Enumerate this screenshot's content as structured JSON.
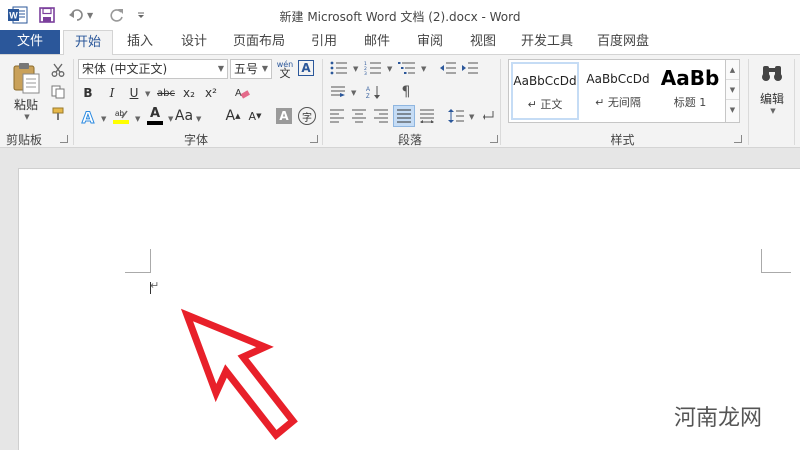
{
  "titlebar": {
    "title": "新建 Microsoft Word 文档 (2).docx - Word",
    "app_logo": "word-logo-icon",
    "quick_access": [
      "save-icon",
      "undo-icon",
      "redo-icon",
      "customize-icon"
    ]
  },
  "tabs": {
    "file": "文件",
    "items": [
      "开始",
      "插入",
      "设计",
      "页面布局",
      "引用",
      "邮件",
      "审阅",
      "视图",
      "开发工具",
      "百度网盘"
    ],
    "active": "开始"
  },
  "ribbon": {
    "clipboard": {
      "paste_label": "粘贴",
      "group_label": "剪贴板"
    },
    "font": {
      "font_name": "宋体 (中文正文)",
      "font_size": "五号",
      "phonetic_label": "wén",
      "phonetic_char": "文",
      "border_char": "A",
      "bold": "B",
      "italic": "I",
      "underline": "U",
      "strike": "abc",
      "subscript": "x₂",
      "superscript": "x²",
      "grow": "A",
      "shrink": "A",
      "shade_char": "A",
      "enclose_char": "字",
      "group_label": "字体"
    },
    "paragraph": {
      "group_label": "段落"
    },
    "styles": {
      "items": [
        {
          "sample": "AaBbCcDd",
          "name": "↵ 正文"
        },
        {
          "sample": "AaBbCcDd",
          "name": "↵ 无间隔"
        },
        {
          "sample": "AaBb",
          "name": "标题 1"
        }
      ],
      "group_label": "样式"
    },
    "editing": {
      "label": "编辑"
    }
  },
  "document": {
    "paragraph_mark": "↵"
  },
  "watermark": "河南龙网",
  "colors": {
    "accent": "#2b579a",
    "highlight": "#ffff00",
    "font_color": "#000000",
    "arrow": "#e8202a"
  }
}
